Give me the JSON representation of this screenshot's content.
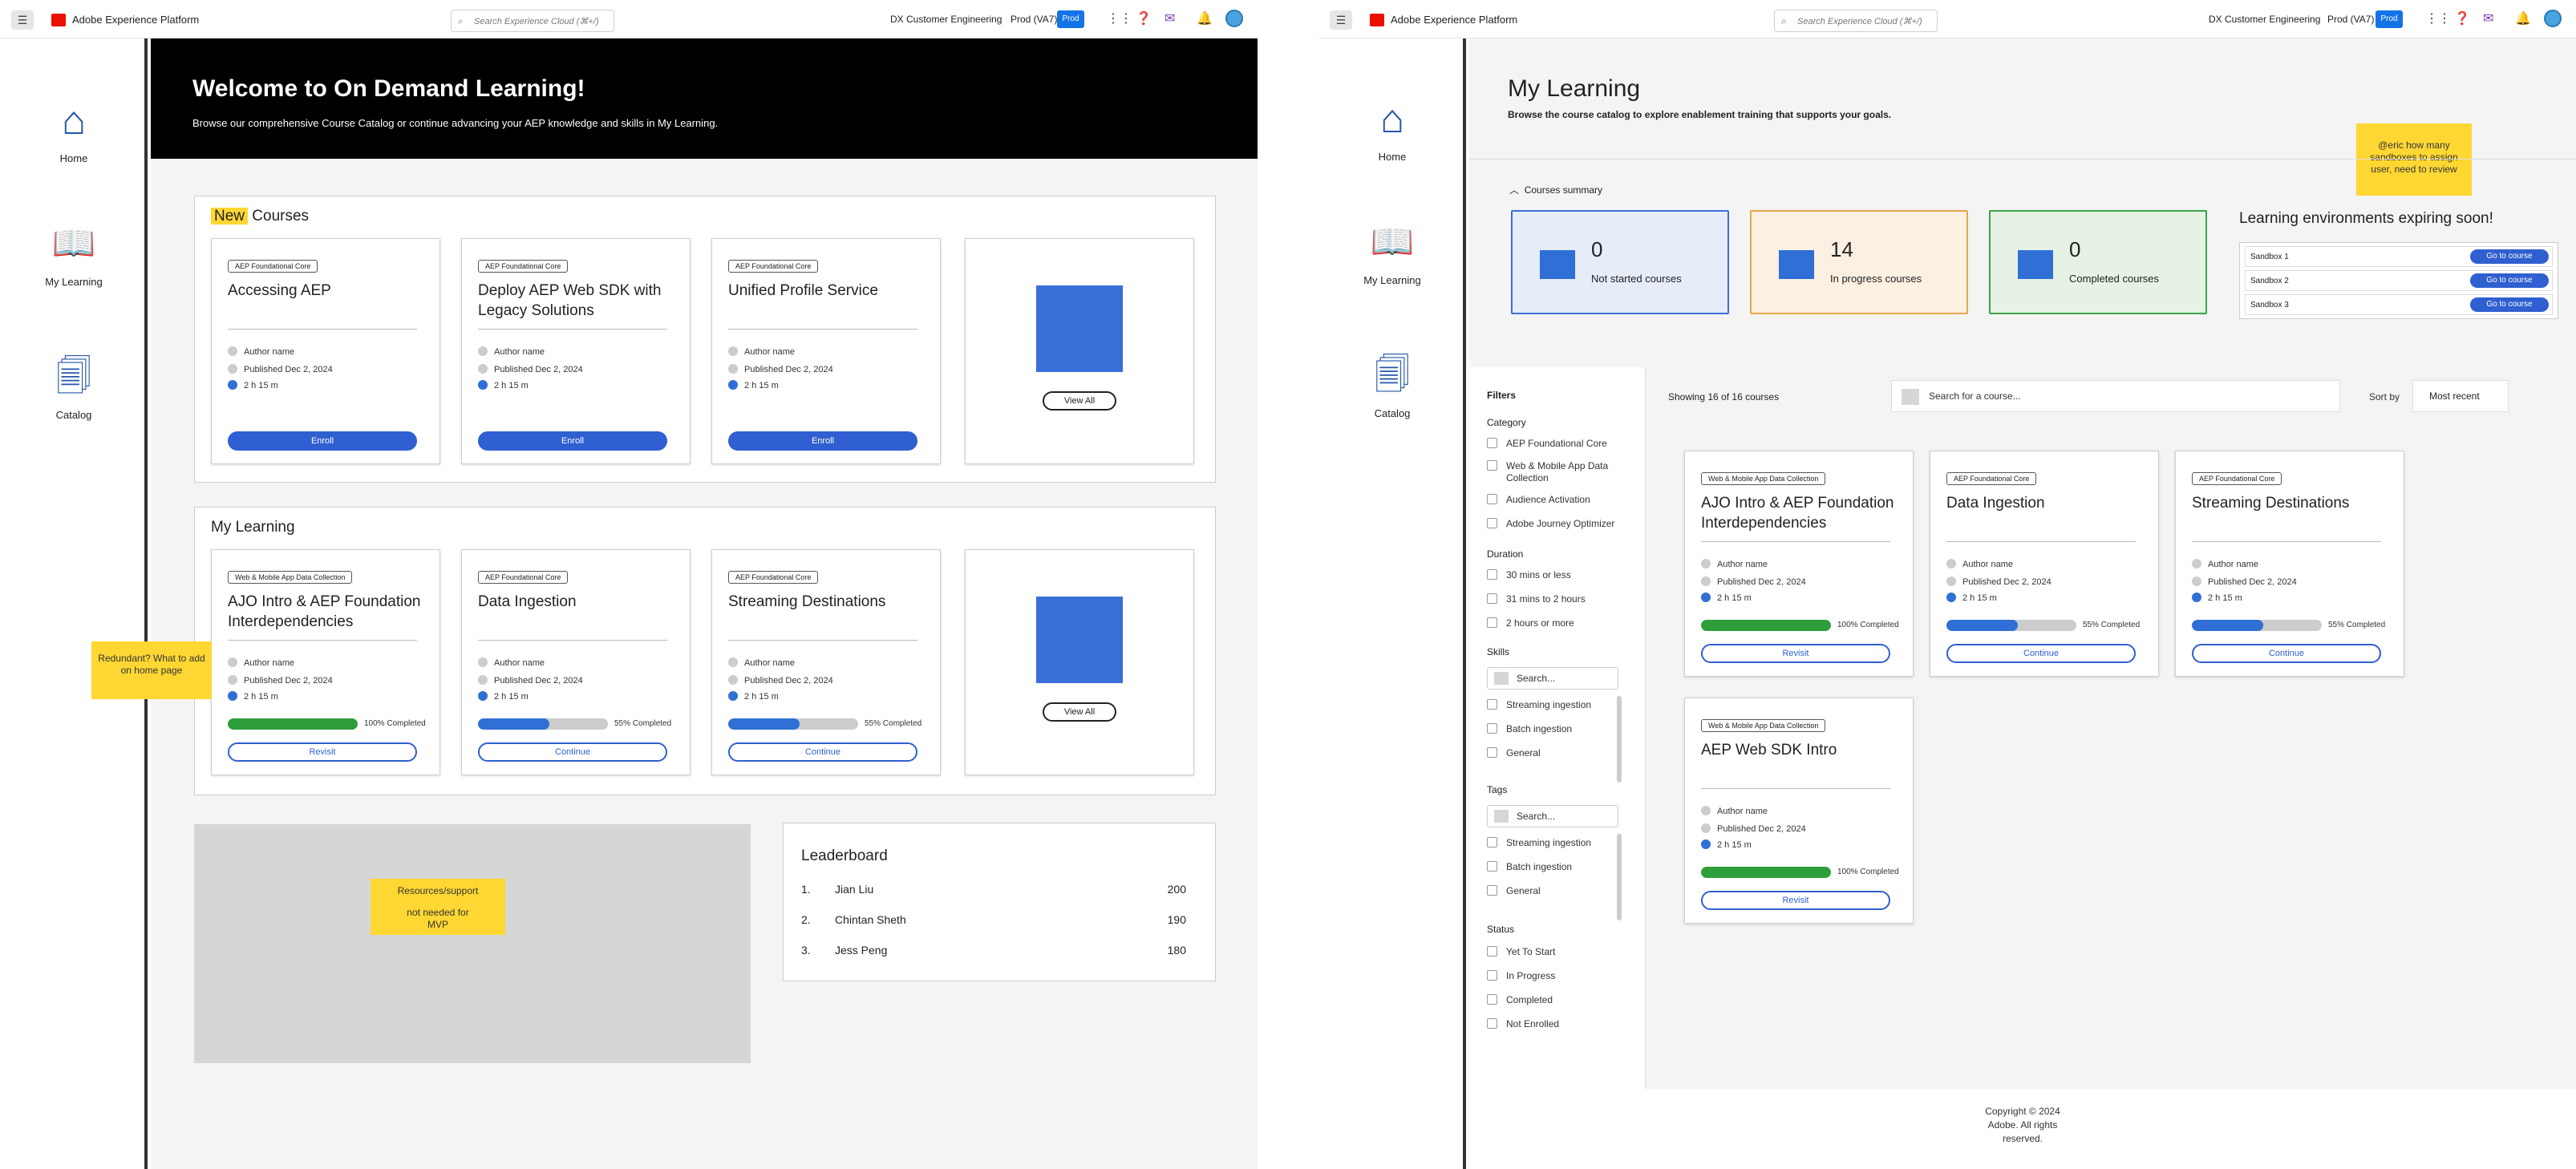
{
  "topbar": {
    "app_title": "Adobe Experience Platform",
    "search_placeholder": "Search Experience Cloud (⌘+/)",
    "org": "DX Customer Engineering",
    "sandbox": "Prod (VA7)",
    "env_badge": "Prod"
  },
  "nav": {
    "items": [
      {
        "label": "Home",
        "icon": "home-icon"
      },
      {
        "label": "My Learning",
        "icon": "book-icon"
      },
      {
        "label": "Catalog",
        "icon": "catalog-icon"
      }
    ]
  },
  "home": {
    "hero": {
      "title": "Welcome to On Demand Learning!",
      "subtitle": "Browse our comprehensive Course Catalog or continue advancing your AEP knowledge and skills in My Learning."
    },
    "new_courses": {
      "title_highlight": "New",
      "title_rest": "Courses",
      "cards": [
        {
          "tag": "AEP Foundational Core",
          "title": "Accessing AEP",
          "author": "Author name",
          "published": "Published Dec 2, 2024",
          "duration": "2 h 15 m",
          "button": "Enroll"
        },
        {
          "tag": "AEP Foundational Core",
          "title": "Deploy AEP Web SDK with Legacy Solutions",
          "author": "Author name",
          "published": "Published Dec 2, 2024",
          "duration": "2 h 15 m",
          "button": "Enroll"
        },
        {
          "tag": "AEP Foundational Core",
          "title": "Unified Profile Service",
          "author": "Author name",
          "published": "Published Dec 2, 2024",
          "duration": "2 h 15 m",
          "button": "Enroll"
        }
      ],
      "view_all": "View All"
    },
    "my_learning": {
      "title": "My Learning",
      "cards": [
        {
          "tag": "Web & Mobile App Data Collection",
          "title": "AJO Intro & AEP Foundation Interdependencies",
          "author": "Author name",
          "published": "Published Dec 2, 2024",
          "duration": "2 h 15 m",
          "progress": 1.0,
          "progress_label": "100% Completed",
          "button": "Revisit"
        },
        {
          "tag": "AEP Foundational Core",
          "title": "Data Ingestion",
          "author": "Author name",
          "published": "Published Dec 2, 2024",
          "duration": "2 h 15 m",
          "progress": 0.55,
          "progress_label": "55% Completed",
          "button": "Continue"
        },
        {
          "tag": "AEP Foundational Core",
          "title": "Streaming Destinations",
          "author": "Author name",
          "published": "Published Dec 2, 2024",
          "duration": "2 h 15 m",
          "progress": 0.55,
          "progress_label": "55% Completed",
          "button": "Continue"
        }
      ],
      "view_all": "View All"
    },
    "sticky_redundant": "Redundant? What to add on home page",
    "sticky_resources_1": "Resources/support",
    "sticky_resources_2": "not needed for MVP",
    "leaderboard": {
      "title": "Leaderboard",
      "rows": [
        {
          "rank": "1.",
          "name": "Jian Liu",
          "score": "200"
        },
        {
          "rank": "2.",
          "name": "Chintan Sheth",
          "score": "190"
        },
        {
          "rank": "3.",
          "name": "Jess Peng",
          "score": "180"
        }
      ]
    }
  },
  "mylearning": {
    "title": "My Learning",
    "subtitle": "Browse the course catalog to explore enablement training that supports your goals.",
    "sticky_note": "@eric how many sandboxes to assign user, need to review",
    "summary_header": "Courses summary",
    "stats": [
      {
        "value": "0",
        "label": "Not started courses",
        "border": "#3b6fd8",
        "bg": "#e6ecf8"
      },
      {
        "value": "14",
        "label": "In progress courses",
        "border": "#e9a64a",
        "bg": "#fbf0e2"
      },
      {
        "value": "0",
        "label": "Completed courses",
        "border": "#3aa24a",
        "bg": "#e6f3e4"
      }
    ],
    "expiring": {
      "title": "Learning environments expiring soon!",
      "rows": [
        {
          "name": "Sandbox 1",
          "button": "Go to course"
        },
        {
          "name": "Sandbox 2",
          "button": "Go to course"
        },
        {
          "name": "Sandbox 3",
          "button": "Go to course"
        }
      ]
    },
    "filters": {
      "title": "Filters",
      "category_label": "Category",
      "categories": [
        "AEP Foundational Core",
        "Web & Mobile App Data Collection",
        "Audience Activation",
        "Adobe Journey Optimizer"
      ],
      "duration_label": "Duration",
      "durations": [
        "30 mins or less",
        "31 mins to 2 hours",
        "2 hours or more"
      ],
      "skills_label": "Skills",
      "skills_search": "Search...",
      "skills": [
        "Streaming ingestion",
        "Batch ingestion",
        "General"
      ],
      "tags_label": "Tags",
      "tags_search": "Search...",
      "tags": [
        "Streaming ingestion",
        "Batch ingestion",
        "General"
      ],
      "status_label": "Status",
      "statuses": [
        "Yet To Start",
        "In Progress",
        "Completed",
        "Not Enrolled"
      ]
    },
    "showing": "Showing 16 of 16 courses",
    "course_search": "Search for a course...",
    "sort_label": "Sort by",
    "sort_value": "Most recent",
    "cards": [
      {
        "tag": "Web & Mobile App Data Collection",
        "title": "AJO Intro & AEP Foundation Interdependencies",
        "author": "Author name",
        "published": "Published Dec 2, 2024",
        "duration": "2 h 15 m",
        "progress": 1.0,
        "progress_label": "100% Completed",
        "button": "Revisit"
      },
      {
        "tag": "AEP Foundational Core",
        "title": "Data Ingestion",
        "author": "Author name",
        "published": "Published Dec 2, 2024",
        "duration": "2 h 15 m",
        "progress": 0.55,
        "progress_label": "55% Completed",
        "button": "Continue"
      },
      {
        "tag": "AEP Foundational Core",
        "title": "Streaming Destinations",
        "author": "Author name",
        "published": "Published Dec 2, 2024",
        "duration": "2 h 15 m",
        "progress": 0.55,
        "progress_label": "55% Completed",
        "button": "Continue"
      },
      {
        "tag": "Web & Mobile App Data Collection",
        "title": "AEP Web SDK Intro",
        "author": "Author name",
        "published": "Published Dec 2, 2024",
        "duration": "2 h 15 m",
        "progress": 1.0,
        "progress_label": "100% Completed",
        "button": "Revisit"
      }
    ],
    "footer": "Copyright © 2024 Adobe. All rights reserved."
  }
}
